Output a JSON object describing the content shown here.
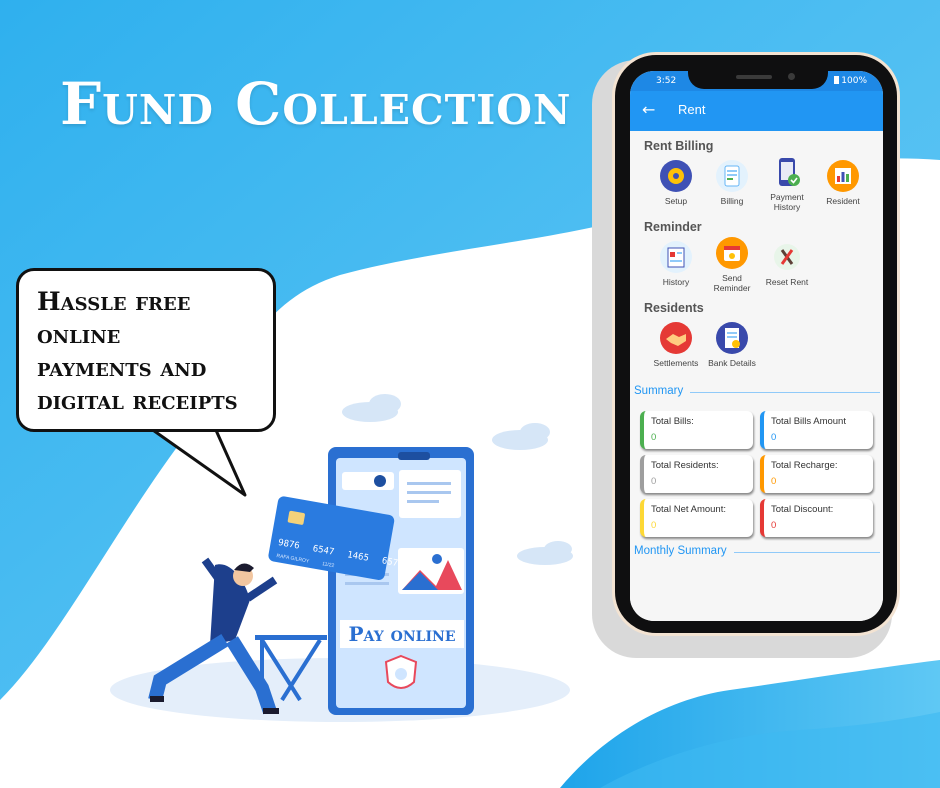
{
  "headline": "Fund Collection",
  "bubble": {
    "lines": [
      "Hassle free",
      "online",
      "payments and",
      "digital receipts"
    ]
  },
  "illustration": {
    "card_number": [
      "9876",
      "6547",
      "1465",
      "6574"
    ],
    "card_holder": "RAFA GILROY",
    "card_expiry": "11/22",
    "pay_label": "Pay online"
  },
  "phone": {
    "status_time": "3:52",
    "status_battery": "100%",
    "appbar_title": "Rent",
    "back_icon": "arrow-left-icon",
    "sections": {
      "rent_billing": {
        "title": "Rent Billing",
        "items": [
          {
            "label": "Setup",
            "icon": "gear-coins-icon"
          },
          {
            "label": "Billing",
            "icon": "invoice-icon"
          },
          {
            "label": "Payment History",
            "icon": "payment-history-icon"
          },
          {
            "label": "Resident",
            "icon": "resident-report-icon"
          }
        ]
      },
      "reminder": {
        "title": "Reminder",
        "items": [
          {
            "label": "History",
            "icon": "history-report-icon"
          },
          {
            "label": "Send Reminder",
            "icon": "calendar-bell-icon"
          },
          {
            "label": "Reset Rent",
            "icon": "tools-icon"
          }
        ]
      },
      "residents": {
        "title": "Residents",
        "items": [
          {
            "label": "Settlements",
            "icon": "handshake-icon"
          },
          {
            "label": "Bank Details",
            "icon": "bank-document-icon"
          }
        ]
      }
    },
    "summary": {
      "label": "Summary",
      "cards": [
        {
          "title": "Total Bills:",
          "value": "0",
          "color": "#4caf50"
        },
        {
          "title": "Total Bills Amount",
          "value": "0",
          "color": "#2196f3"
        },
        {
          "title": "Total Residents:",
          "value": "0",
          "color": "#9e9e9e"
        },
        {
          "title": "Total Recharge:",
          "value": "0",
          "color": "#ff9800"
        },
        {
          "title": "Total Net Amount:",
          "value": "0",
          "color": "#fdd835"
        },
        {
          "title": "Total Discount:",
          "value": "0",
          "color": "#e53935"
        }
      ]
    },
    "monthly_summary_label": "Monthly Summary"
  },
  "colors": {
    "sky": "#38b6f0",
    "sky_light": "#7fd0f5",
    "primary": "#2196f3"
  }
}
